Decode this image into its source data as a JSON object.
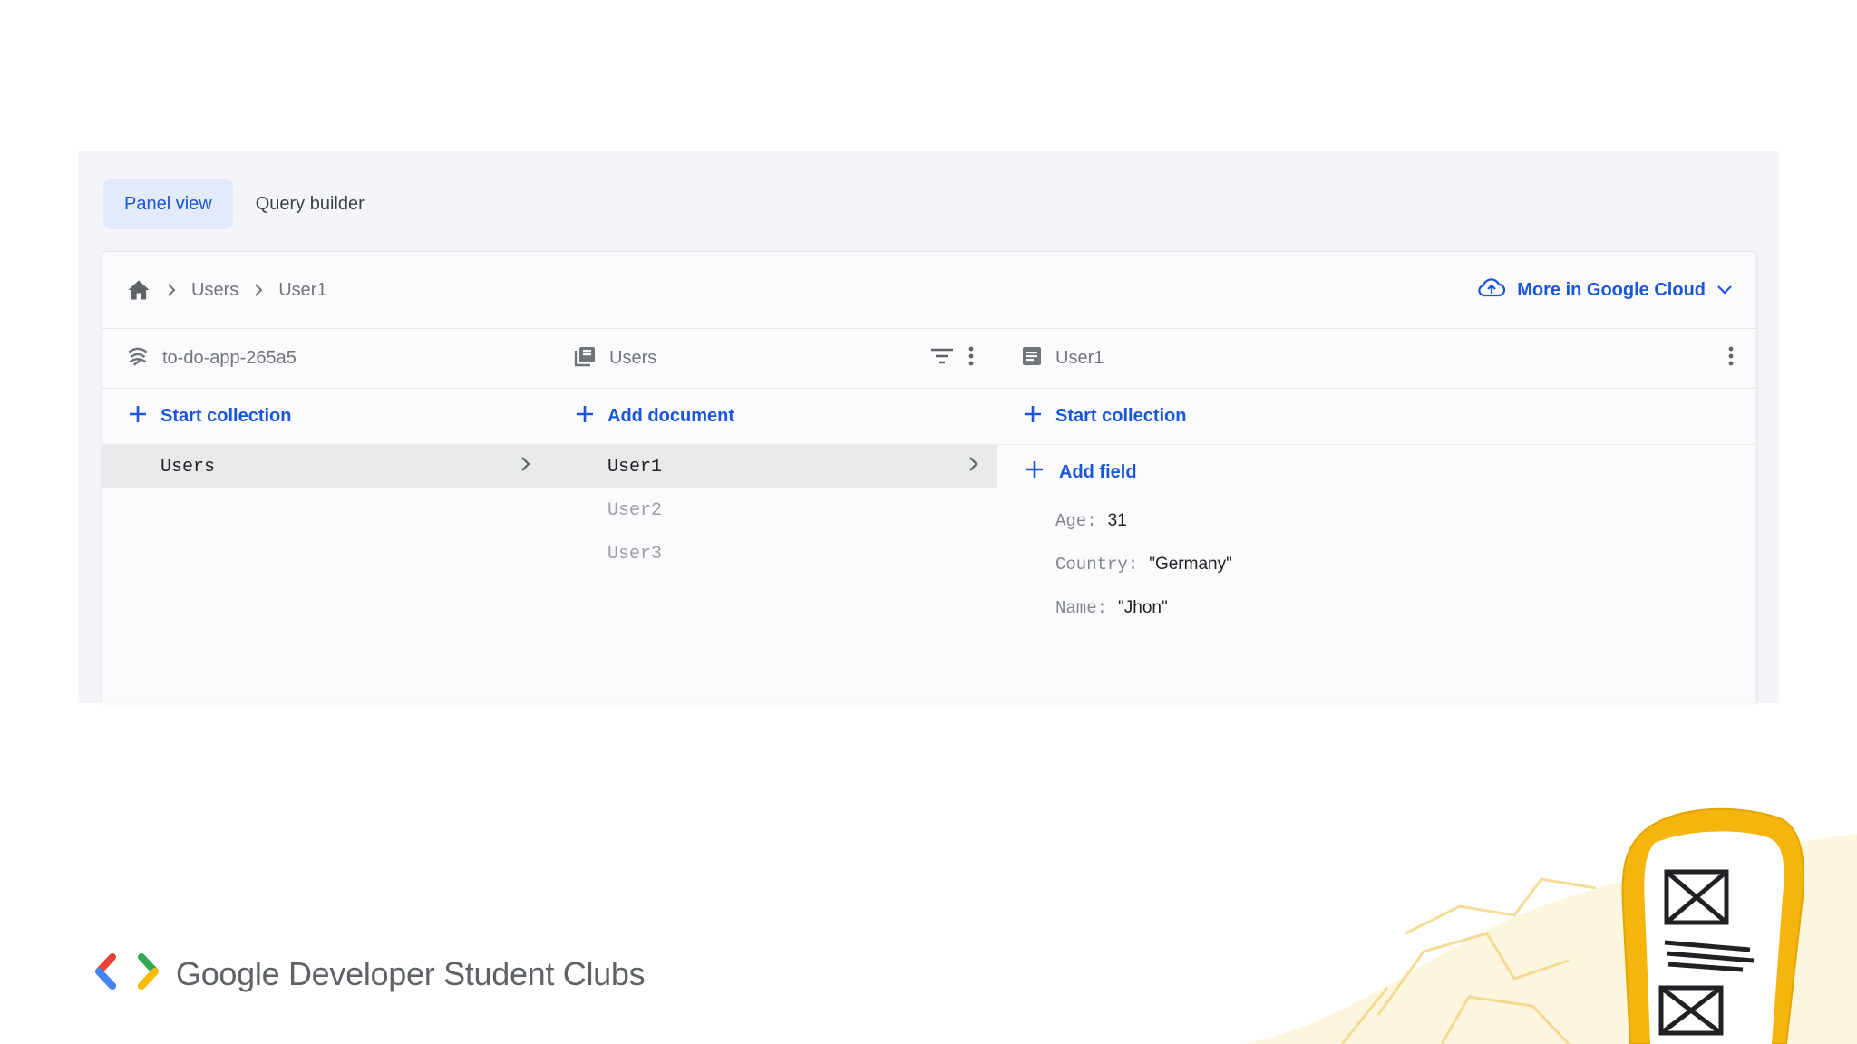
{
  "tabs": [
    {
      "label": "Panel view",
      "active": true
    },
    {
      "label": "Query builder",
      "active": false
    }
  ],
  "breadcrumb": {
    "items": [
      "Users",
      "User1"
    ],
    "more_link": "More in Google Cloud"
  },
  "panels": {
    "root": {
      "title": "to-do-app-265a5",
      "action": "Start collection",
      "items": [
        {
          "label": "Users",
          "selected": true
        }
      ]
    },
    "collection": {
      "title": "Users",
      "action": "Add document",
      "items": [
        {
          "label": "User1",
          "selected": true
        },
        {
          "label": "User2",
          "selected": false
        },
        {
          "label": "User3",
          "selected": false
        }
      ]
    },
    "document": {
      "title": "User1",
      "action": "Start collection",
      "add_field": "Add field",
      "fields": [
        {
          "key": "Age:",
          "value": "31"
        },
        {
          "key": "Country:",
          "value": "\"Germany\""
        },
        {
          "key": "Name:",
          "value": "\"Jhon\""
        }
      ]
    }
  },
  "brand": {
    "text": "Google Developer Student Clubs",
    "colors": {
      "red": "#ea4335",
      "blue": "#4285f4",
      "green": "#34a853",
      "yellow": "#fbbc04"
    }
  },
  "theme": {
    "accent": "#1a56d6",
    "illustration_yellow": "#f6b40e"
  }
}
